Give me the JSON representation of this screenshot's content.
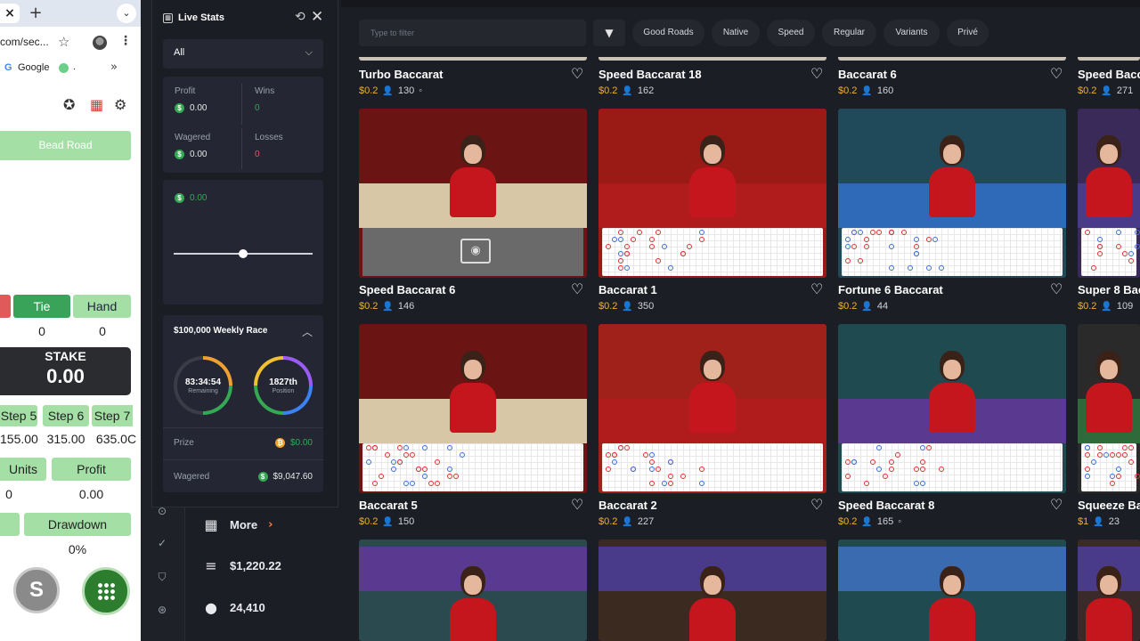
{
  "browser": {
    "tab_close": "×",
    "tab_new": "+",
    "tab_more": "⌄",
    "url": "com/sec...",
    "bookmarks": [
      {
        "label": "Google"
      },
      {
        "label": "."
      }
    ],
    "bookmarks_overflow": "»"
  },
  "tracker": {
    "bead_road": "Bead Road",
    "tie_label": "Tie",
    "hand_label": "Hand",
    "tie_count": "0",
    "hand_count": "0",
    "stake_label": "STAKE",
    "stake_value": "0.00",
    "steps": [
      {
        "label": "Step 5",
        "value": "155.00"
      },
      {
        "label": "Step 6",
        "value": "315.00"
      },
      {
        "label": "Step 7",
        "value": "635.0C"
      }
    ],
    "units_label": "Units",
    "units_value": "0",
    "profit_label": "Profit",
    "profit_value": "0.00",
    "drawdown_label": "Drawdown",
    "drawdown_value": "0%",
    "s_button": "S"
  },
  "live_stats": {
    "title": "Live Stats",
    "filter_value": "All",
    "profit_label": "Profit",
    "profit_value": "0.00",
    "wins_label": "Wins",
    "wins_value": "0",
    "wagered_label": "Wagered",
    "wagered_value": "0.00",
    "losses_label": "Losses",
    "losses_value": "0",
    "chart_value": "0.00",
    "slider_fraction": 0.5,
    "race": {
      "title": "$100,000 Weekly Race",
      "time": "83:34:54",
      "time_label": "Remaining",
      "position": "1827th",
      "position_label": "Position",
      "prize_label": "Prize",
      "prize_value": "$0.00",
      "wagered_label": "Wagered",
      "wagered_value": "$9,047.60"
    },
    "colors": {
      "green": "#34a853",
      "red": "#e05a5a",
      "wins": "#34a853"
    }
  },
  "leftnav": {
    "more_label": "More",
    "balance": "$1,220.22",
    "players": "24,410"
  },
  "filters": {
    "placeholder": "Type to filter",
    "chips": [
      "Good Roads",
      "Native",
      "Speed",
      "Regular",
      "Variants",
      "Privé"
    ]
  },
  "games": [
    {
      "title": "Turbo Baccarat",
      "price": "$0.2",
      "players": "130",
      "extra": "◦"
    },
    {
      "title": "Speed Baccarat 18",
      "price": "$0.2",
      "players": "162",
      "extra": ""
    },
    {
      "title": "Baccarat 6",
      "price": "$0.2",
      "players": "160",
      "extra": ""
    },
    {
      "title": "Speed Bacc",
      "price": "$0.2",
      "players": "271",
      "extra": ""
    },
    {
      "title": "Speed Baccarat 6",
      "price": "$0.2",
      "players": "146",
      "extra": ""
    },
    {
      "title": "Baccarat 1",
      "price": "$0.2",
      "players": "350",
      "extra": ""
    },
    {
      "title": "Fortune 6 Baccarat",
      "price": "$0.2",
      "players": "44",
      "extra": ""
    },
    {
      "title": "Super 8 Bac",
      "price": "$0.2",
      "players": "109",
      "extra": ""
    },
    {
      "title": "Baccarat 5",
      "price": "$0.2",
      "players": "150",
      "extra": ""
    },
    {
      "title": "Baccarat 2",
      "price": "$0.2",
      "players": "227",
      "extra": ""
    },
    {
      "title": "Speed Baccarat 8",
      "price": "$0.2",
      "players": "165",
      "extra": "◦"
    },
    {
      "title": "Squeeze Ba",
      "price": "$1",
      "players": "23",
      "extra": ""
    }
  ],
  "thumb_themes": [
    {
      "bg": "#6b1414",
      "table": "#d8c7a6"
    },
    {
      "bg": "#9a1a16",
      "table": "#b01c1c"
    },
    {
      "bg": "#204a5a",
      "table": "#2e6ab8"
    },
    {
      "bg": "#3a2a5a",
      "table": "#4a3a8a"
    },
    {
      "bg": "#6b1414",
      "table": "#d8c7a6"
    },
    {
      "bg": "#a0201a",
      "table": "#b01c1c"
    },
    {
      "bg": "#1f4a50",
      "table": "#5a3a90"
    },
    {
      "bg": "#2a2a2a",
      "table": "#2f6a3a"
    },
    {
      "bg": "#2a4a50",
      "table": "#5a3a90"
    },
    {
      "bg": "#3a2a20",
      "table": "#4a3a8a"
    },
    {
      "bg": "#1f4a50",
      "table": "#3a6ab0"
    },
    {
      "bg": "#3a2a2a",
      "table": "#4a3a8a"
    }
  ]
}
